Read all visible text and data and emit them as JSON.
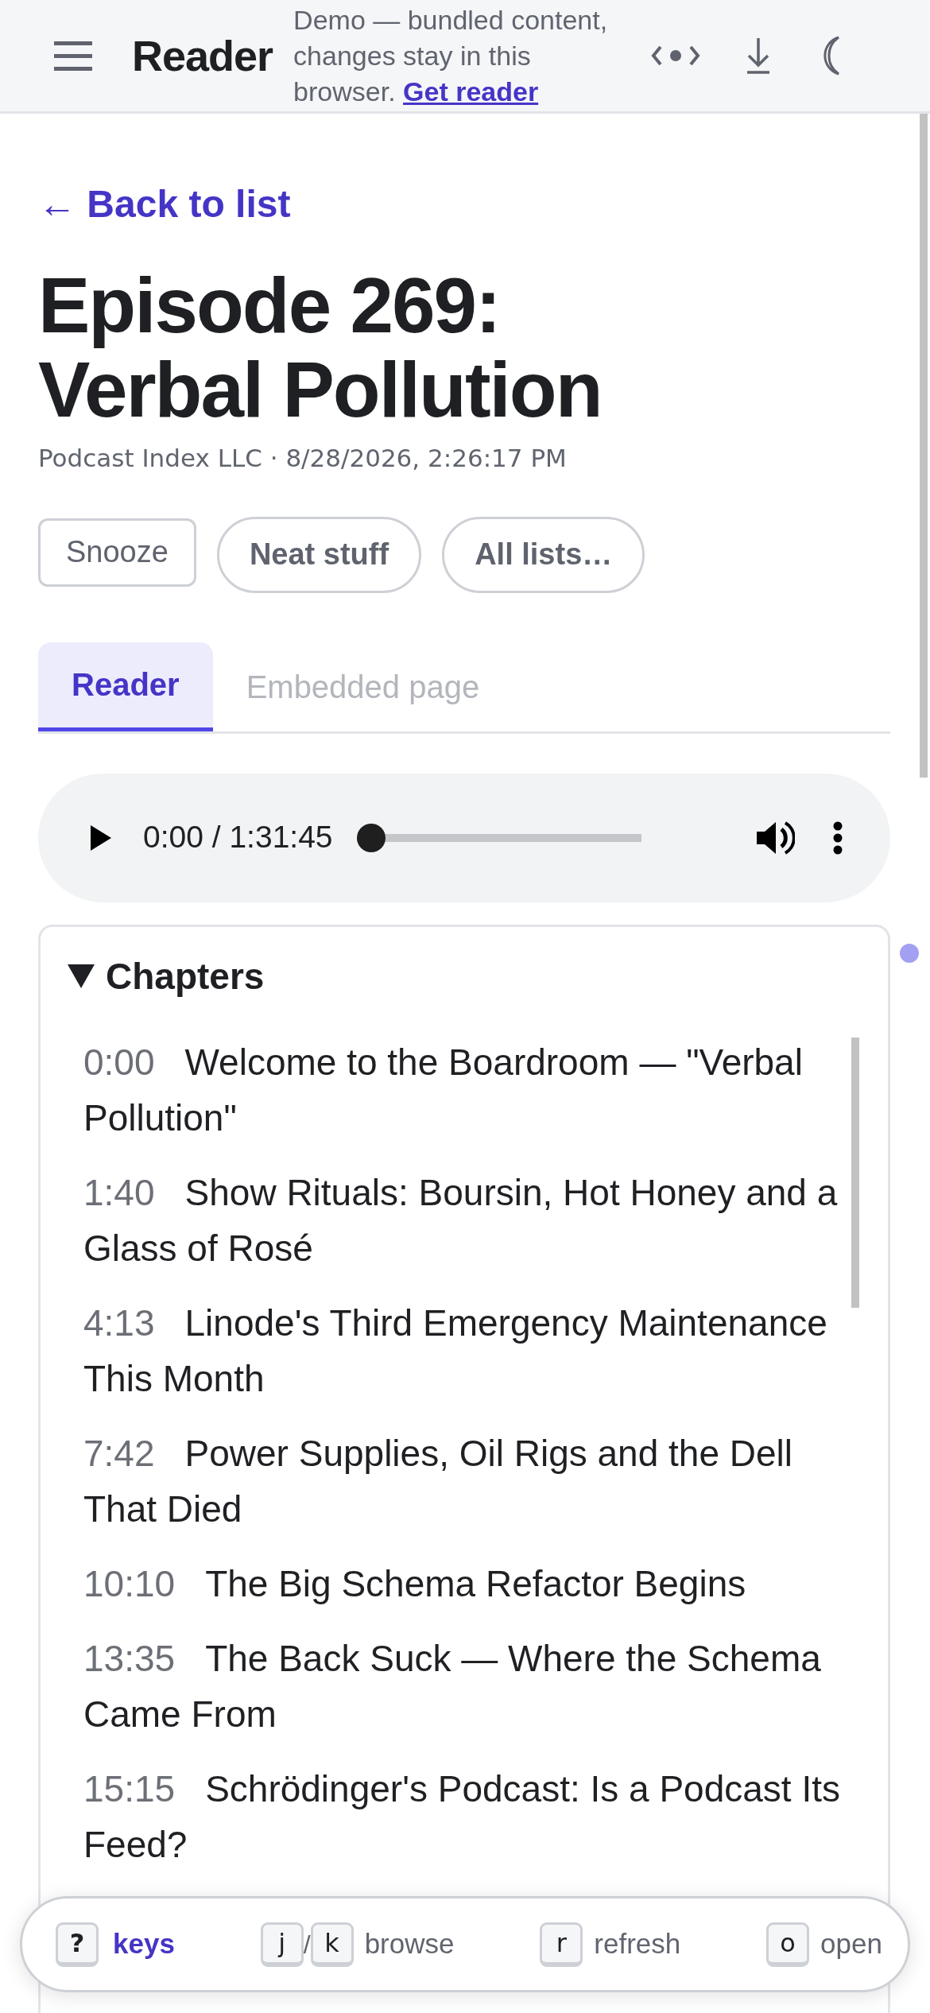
{
  "header": {
    "title": "Reader",
    "notice": "Demo — bundled content, changes stay in this browser.",
    "notice_link": "Get reader"
  },
  "back_link": "← Back to list",
  "article": {
    "title": "Episode 269: Verbal Pollution",
    "meta": "Podcast Index LLC · 8/28/2026, 2:26:17 PM"
  },
  "actions": [
    {
      "label": "Snooze",
      "kind": "outline"
    },
    {
      "label": "Neat stuff",
      "kind": "pill"
    },
    {
      "label": "All lists…",
      "kind": "pill"
    }
  ],
  "tabs": [
    {
      "label": "Reader",
      "selected": true
    },
    {
      "label": "Embedded page",
      "selected": false
    }
  ],
  "player": {
    "time": "0:00 / 1:31:45",
    "level": 0
  },
  "chapters": {
    "title": "Chapters",
    "expanded": true,
    "items": [
      {
        "time": "0:00",
        "title": "Welcome to the Boardroom — \"Verbal Pollution\""
      },
      {
        "time": "1:40",
        "title": "Show Rituals: Boursin, Hot Honey and a Glass of Rosé"
      },
      {
        "time": "4:13",
        "title": "Linode's Third Emergency Maintenance This Month"
      },
      {
        "time": "7:42",
        "title": "Power Supplies, Oil Rigs and the Dell That Died"
      },
      {
        "time": "10:10",
        "title": "The Big Schema Refactor Begins"
      },
      {
        "time": "13:35",
        "title": "The Back Suck — Where the Schema Came From"
      },
      {
        "time": "15:15",
        "title": "Schrödinger's Podcast: Is a Podcast Its Feed?"
      }
    ]
  },
  "shortcuts": [
    {
      "keys": [
        "?"
      ],
      "label": "keys",
      "kind": "help"
    },
    {
      "keys": [
        "j",
        "k"
      ],
      "separator": "/",
      "label": "browse",
      "kind": "plain"
    },
    {
      "keys": [
        "r"
      ],
      "label": "refresh",
      "kind": "plain"
    },
    {
      "keys": [
        "o"
      ],
      "label": "open",
      "kind": "plain"
    }
  ]
}
